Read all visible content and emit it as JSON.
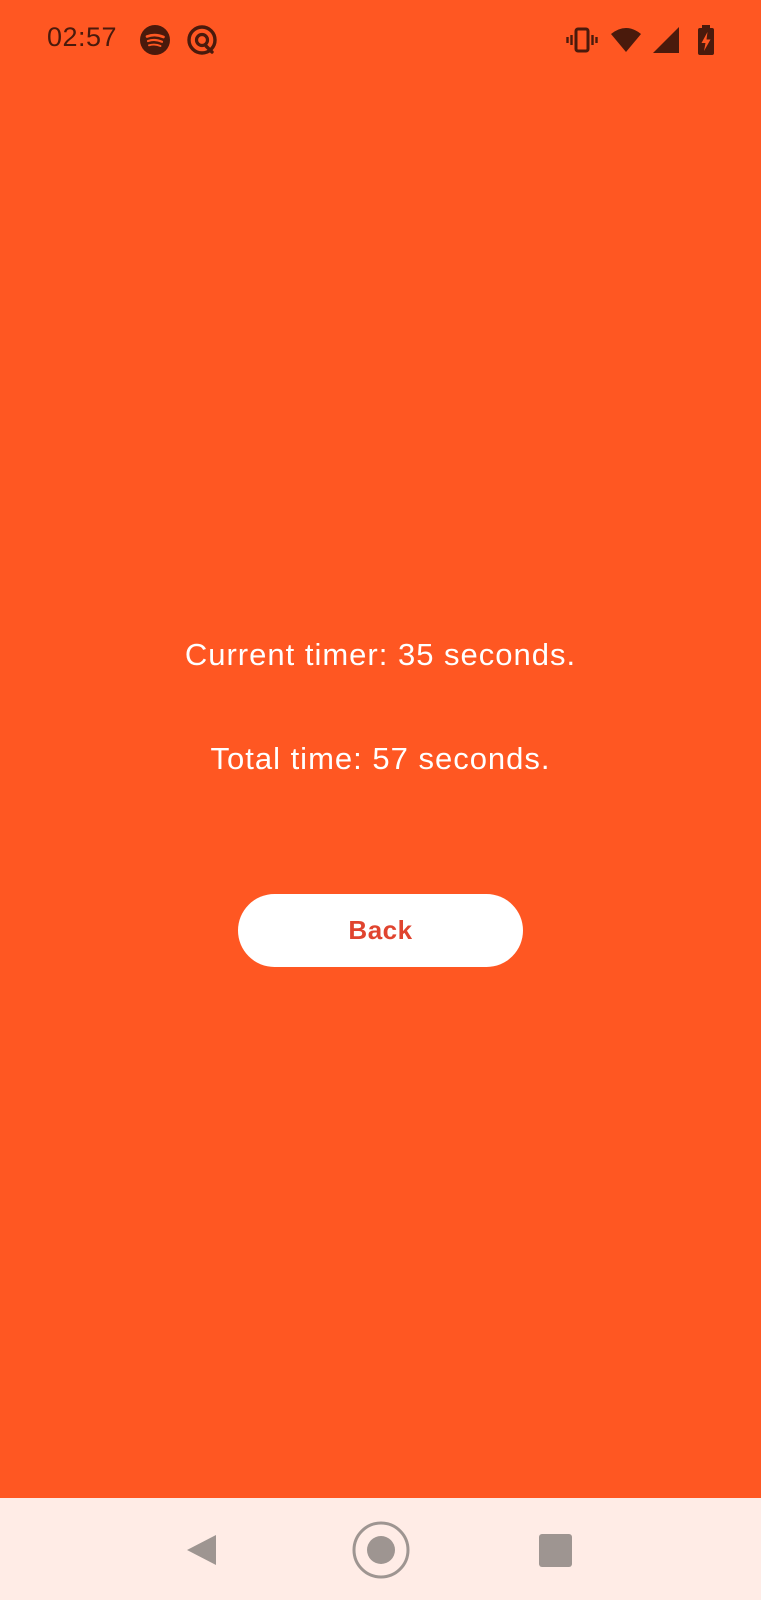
{
  "status_bar": {
    "time": "02:57",
    "left_icons": [
      "spotify-icon",
      "at-sign-icon"
    ],
    "right_icons": [
      "vibrate-icon",
      "wifi-icon",
      "cell-signal-icon",
      "battery-charging-icon"
    ]
  },
  "main": {
    "current_timer_text": "Current timer: 35 seconds.",
    "total_time_text": "Total time: 57 seconds.",
    "back_button_label": "Back"
  },
  "nav_bar": {
    "buttons": [
      "back-triangle-icon",
      "home-circle-icon",
      "recents-square-icon"
    ]
  },
  "colors": {
    "background": "#FF5722",
    "nav_background": "#FFECE6",
    "button_background": "#FFFFFF",
    "button_text": "#E0442F",
    "status_foreground": "#4A1A0C",
    "nav_icon": "#9E9591"
  }
}
